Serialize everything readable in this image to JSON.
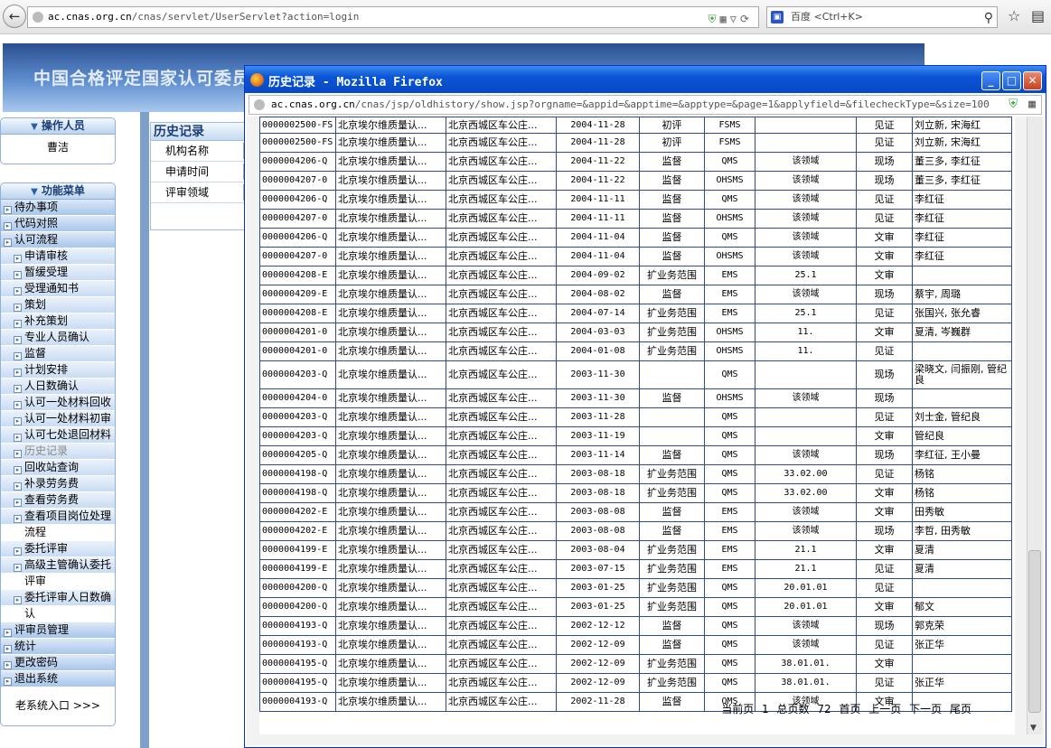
{
  "browser": {
    "url_host": "ac.cnas.org.cn",
    "url_path": "/cnas/servlet/UserServlet?action=login",
    "search_text": "百度 <Ctrl+K>"
  },
  "page": {
    "site_title": "中国合格评定国家认可委员会",
    "operator_header": "操作人员",
    "operator_name": "曹洁",
    "menu_header": "功能菜单",
    "menu": [
      {
        "label": "待办事项",
        "level": "top"
      },
      {
        "label": "代码对照",
        "level": "top"
      },
      {
        "label": "认可流程",
        "level": "top"
      },
      {
        "label": "申请审核",
        "level": "sub"
      },
      {
        "label": "暂缓受理",
        "level": "sub"
      },
      {
        "label": "受理通知书",
        "level": "sub"
      },
      {
        "label": "策划",
        "level": "sub"
      },
      {
        "label": "补充策划",
        "level": "sub"
      },
      {
        "label": "专业人员确认",
        "level": "sub"
      },
      {
        "label": "监督",
        "level": "sub"
      },
      {
        "label": "计划安排",
        "level": "sub"
      },
      {
        "label": "人日数确认",
        "level": "sub"
      },
      {
        "label": "认可一处材料回收",
        "level": "sub"
      },
      {
        "label": "认可一处材料初审",
        "level": "sub"
      },
      {
        "label": "认可七处退回材料",
        "level": "sub"
      },
      {
        "label": "历史记录",
        "level": "sub-dim"
      },
      {
        "label": "回收站查询",
        "level": "sub"
      },
      {
        "label": "补录劳务费",
        "level": "sub"
      },
      {
        "label": "查看劳务费",
        "level": "sub"
      },
      {
        "label": "查看项目岗位处理",
        "level": "sub"
      },
      {
        "label": "流程",
        "level": "cont"
      },
      {
        "label": "委托评审",
        "level": "sub"
      },
      {
        "label": "高级主管确认委托",
        "level": "sub"
      },
      {
        "label": "评审",
        "level": "cont"
      },
      {
        "label": "委托评审人日数确",
        "level": "sub"
      },
      {
        "label": "认",
        "level": "cont"
      },
      {
        "label": "评审员管理",
        "level": "top"
      },
      {
        "label": "统计",
        "level": "top"
      },
      {
        "label": "更改密码",
        "level": "top"
      },
      {
        "label": "退出系统",
        "level": "top"
      }
    ],
    "old_system_link": "老系统入口 >>>",
    "history_panel": {
      "title": "历史记录",
      "fields": [
        "机构名称",
        "申请时间",
        "评审领域"
      ]
    }
  },
  "popup": {
    "title": "历史记录 - Mozilla Firefox",
    "url_host": "ac.cnas.org.cn",
    "url_path": "/cnas/jsp/oldhistory/show.jsp?orgname=&appid=&apptime=&apptype=&page=1&applyfield=&filecheckType=&size=100",
    "rows": [
      [
        "0000002500-FS",
        "北京埃尔维质量认...",
        "北京西城区车公庄...",
        "2004-11-28",
        "初评",
        "FSMS",
        "",
        "见证",
        "刘立新, 宋海红"
      ],
      [
        "0000002500-FS",
        "北京埃尔维质量认...",
        "北京西城区车公庄...",
        "2004-11-28",
        "初评",
        "FSMS",
        "",
        "见证",
        "刘立新, 宋海红"
      ],
      [
        "0000004206-Q",
        "北京埃尔维质量认...",
        "北京西城区车公庄...",
        "2004-11-22",
        "监督",
        "QMS",
        "该领域",
        "现场",
        "董三多, 李红征"
      ],
      [
        "0000004207-0",
        "北京埃尔维质量认...",
        "北京西城区车公庄...",
        "2004-11-22",
        "监督",
        "OHSMS",
        "该领域",
        "现场",
        "董三多, 李红征"
      ],
      [
        "0000004206-Q",
        "北京埃尔维质量认...",
        "北京西城区车公庄...",
        "2004-11-11",
        "监督",
        "QMS",
        "该领域",
        "见证",
        "李红征"
      ],
      [
        "0000004207-0",
        "北京埃尔维质量认...",
        "北京西城区车公庄...",
        "2004-11-11",
        "监督",
        "OHSMS",
        "该领域",
        "见证",
        "李红征"
      ],
      [
        "0000004206-Q",
        "北京埃尔维质量认...",
        "北京西城区车公庄...",
        "2004-11-04",
        "监督",
        "QMS",
        "该领域",
        "文审",
        "李红征"
      ],
      [
        "0000004207-0",
        "北京埃尔维质量认...",
        "北京西城区车公庄...",
        "2004-11-04",
        "监督",
        "OHSMS",
        "该领域",
        "文审",
        "李红征"
      ],
      [
        "0000004208-E",
        "北京埃尔维质量认...",
        "北京西城区车公庄...",
        "2004-09-02",
        "扩业务范围",
        "EMS",
        "25.1",
        "文审",
        ""
      ],
      [
        "0000004209-E",
        "北京埃尔维质量认...",
        "北京西城区车公庄...",
        "2004-08-02",
        "监督",
        "EMS",
        "该领域",
        "现场",
        "蔡宇, 周璐"
      ],
      [
        "0000004208-E",
        "北京埃尔维质量认...",
        "北京西城区车公庄...",
        "2004-07-14",
        "扩业务范围",
        "EMS",
        "25.1",
        "见证",
        "张国兴, 张允睿"
      ],
      [
        "0000004201-0",
        "北京埃尔维质量认...",
        "北京西城区车公庄...",
        "2004-03-03",
        "扩业务范围",
        "OHSMS",
        "11.",
        "文审",
        "夏清, 岑巍群"
      ],
      [
        "0000004201-0",
        "北京埃尔维质量认...",
        "北京西城区车公庄...",
        "2004-01-08",
        "扩业务范围",
        "OHSMS",
        "11.",
        "见证",
        ""
      ],
      [
        "0000004203-Q",
        "北京埃尔维质量认...",
        "北京西城区车公庄...",
        "2003-11-30",
        "",
        "QMS",
        "",
        "现场",
        "梁晓文, 闫振刚, 管纪良"
      ],
      [
        "0000004204-0",
        "北京埃尔维质量认...",
        "北京西城区车公庄...",
        "2003-11-30",
        "监督",
        "OHSMS",
        "该领域",
        "现场",
        ""
      ],
      [
        "0000004203-Q",
        "北京埃尔维质量认...",
        "北京西城区车公庄...",
        "2003-11-28",
        "",
        "QMS",
        "",
        "见证",
        "刘士金, 管纪良"
      ],
      [
        "0000004203-Q",
        "北京埃尔维质量认...",
        "北京西城区车公庄...",
        "2003-11-19",
        "",
        "QMS",
        "",
        "文审",
        "管纪良"
      ],
      [
        "0000004205-Q",
        "北京埃尔维质量认...",
        "北京西城区车公庄...",
        "2003-11-14",
        "监督",
        "QMS",
        "该领域",
        "现场",
        "李红征, 王小曼"
      ],
      [
        "0000004198-Q",
        "北京埃尔维质量认...",
        "北京西城区车公庄...",
        "2003-08-18",
        "扩业务范围",
        "QMS",
        "33.02.00",
        "见证",
        "杨铭"
      ],
      [
        "0000004198-Q",
        "北京埃尔维质量认...",
        "北京西城区车公庄...",
        "2003-08-18",
        "扩业务范围",
        "QMS",
        "33.02.00",
        "文审",
        "杨铭"
      ],
      [
        "0000004202-E",
        "北京埃尔维质量认...",
        "北京西城区车公庄...",
        "2003-08-08",
        "监督",
        "EMS",
        "该领域",
        "文审",
        "田秀敏"
      ],
      [
        "0000004202-E",
        "北京埃尔维质量认...",
        "北京西城区车公庄...",
        "2003-08-08",
        "监督",
        "EMS",
        "该领域",
        "现场",
        "李哲, 田秀敏"
      ],
      [
        "0000004199-E",
        "北京埃尔维质量认...",
        "北京西城区车公庄...",
        "2003-08-04",
        "扩业务范围",
        "EMS",
        "21.1",
        "文审",
        "夏清"
      ],
      [
        "0000004199-E",
        "北京埃尔维质量认...",
        "北京西城区车公庄...",
        "2003-07-15",
        "扩业务范围",
        "EMS",
        "21.1",
        "见证",
        "夏清"
      ],
      [
        "0000004200-Q",
        "北京埃尔维质量认...",
        "北京西城区车公庄...",
        "2003-01-25",
        "扩业务范围",
        "QMS",
        "20.01.01",
        "见证",
        ""
      ],
      [
        "0000004200-Q",
        "北京埃尔维质量认...",
        "北京西城区车公庄...",
        "2003-01-25",
        "扩业务范围",
        "QMS",
        "20.01.01",
        "文审",
        "郁文"
      ],
      [
        "0000004193-Q",
        "北京埃尔维质量认...",
        "北京西城区车公庄...",
        "2002-12-12",
        "监督",
        "QMS",
        "该领域",
        "现场",
        "郭克荣"
      ],
      [
        "0000004193-Q",
        "北京埃尔维质量认...",
        "北京西城区车公庄...",
        "2002-12-09",
        "监督",
        "QMS",
        "该领域",
        "见证",
        "张正华"
      ],
      [
        "0000004195-Q",
        "北京埃尔维质量认...",
        "北京西城区车公庄...",
        "2002-12-09",
        "扩业务范围",
        "QMS",
        "38.01.01.",
        "文审",
        ""
      ],
      [
        "0000004195-Q",
        "北京埃尔维质量认...",
        "北京西城区车公庄...",
        "2002-12-09",
        "扩业务范围",
        "QMS",
        "38.01.01.",
        "见证",
        "张正华"
      ],
      [
        "0000004193-Q",
        "北京埃尔维质量认...",
        "北京西城区车公庄...",
        "2002-11-28",
        "监督",
        "QMS",
        "该领域",
        "文审",
        ""
      ]
    ],
    "pager": {
      "current_label": "当前页",
      "current": "1",
      "total_label": "总页数",
      "total": "72",
      "first": "首页",
      "prev": "上一页",
      "next": "下一页",
      "last": "尾页"
    }
  }
}
